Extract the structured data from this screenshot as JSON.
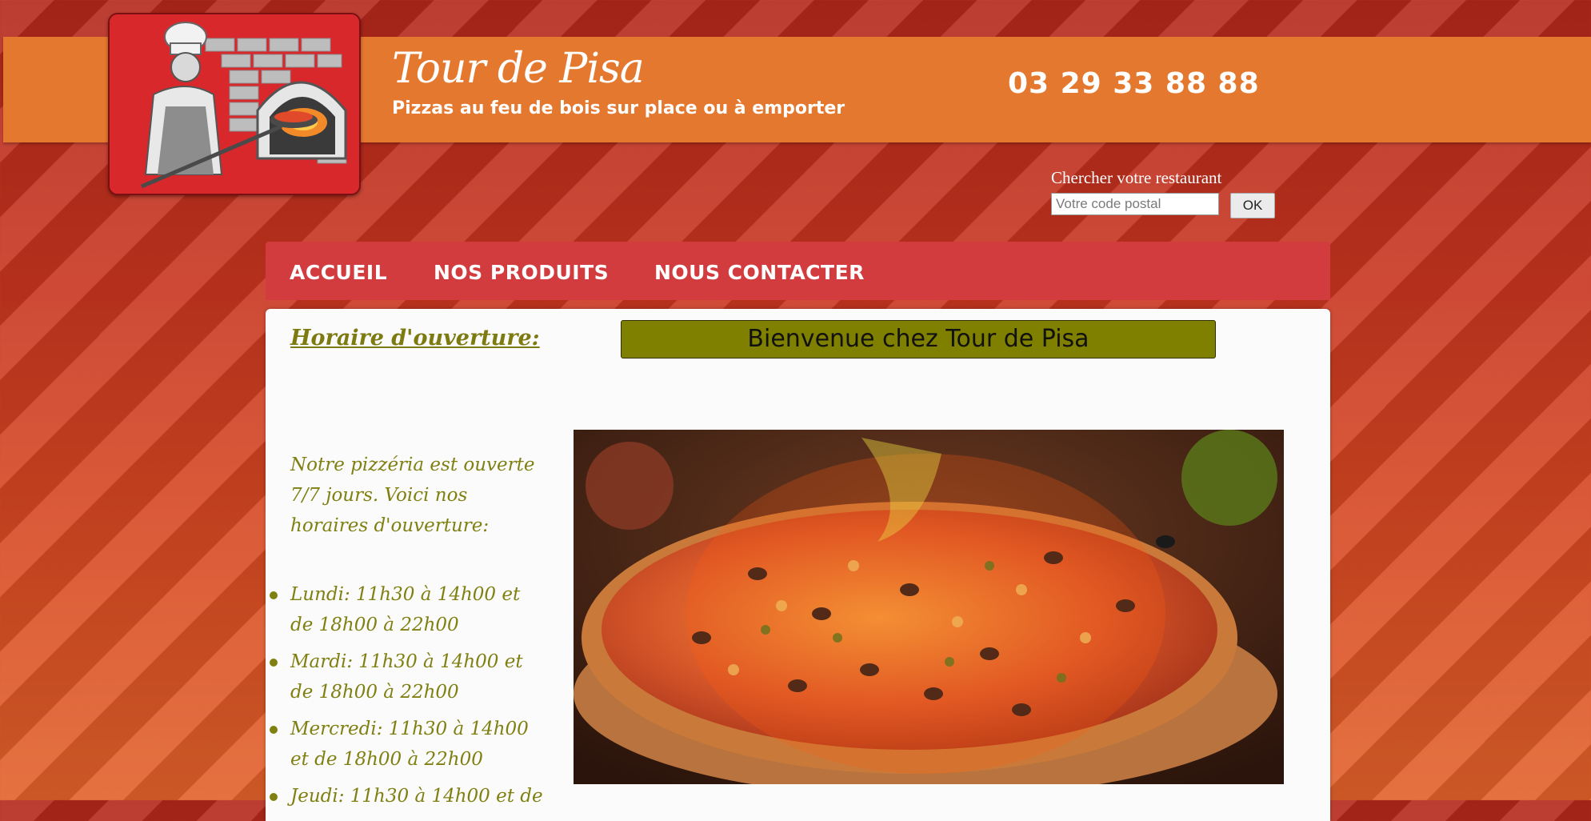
{
  "header": {
    "title": "Tour de Pisa",
    "tagline": "Pizzas au feu de bois sur place ou à emporter",
    "phone": "03 29 33 88 88"
  },
  "search": {
    "label": "Chercher votre restaurant",
    "placeholder": "Votre code postal",
    "button_label": "OK"
  },
  "nav": {
    "items": [
      {
        "label": "Accueil"
      },
      {
        "label": "Nos produits"
      },
      {
        "label": "Nous contacter"
      }
    ]
  },
  "sidebar": {
    "title": "Horaire d'ouverture:",
    "intro": "Notre pizzéria est ouverte 7/7 jours. Voici nos horaires d'ouverture:",
    "hours": [
      "Lundi: 11h30 à 14h00 et de 18h00 à 22h00",
      "Mardi: 11h30 à 14h00 et de 18h00 à 22h00",
      "Mercredi: 11h30 à 14h00 et de 18h00 à 22h00",
      "Jeudi: 11h30 à 14h00 et de"
    ]
  },
  "main": {
    "welcome": "Bienvenue chez Tour de Pisa"
  },
  "colors": {
    "header_band": "#e5782f",
    "nav": "#d33c3f",
    "accent_olive": "#808000",
    "logo_red": "#d8282b"
  },
  "icons": {
    "logo": "pizza-chef-oven-logo"
  }
}
